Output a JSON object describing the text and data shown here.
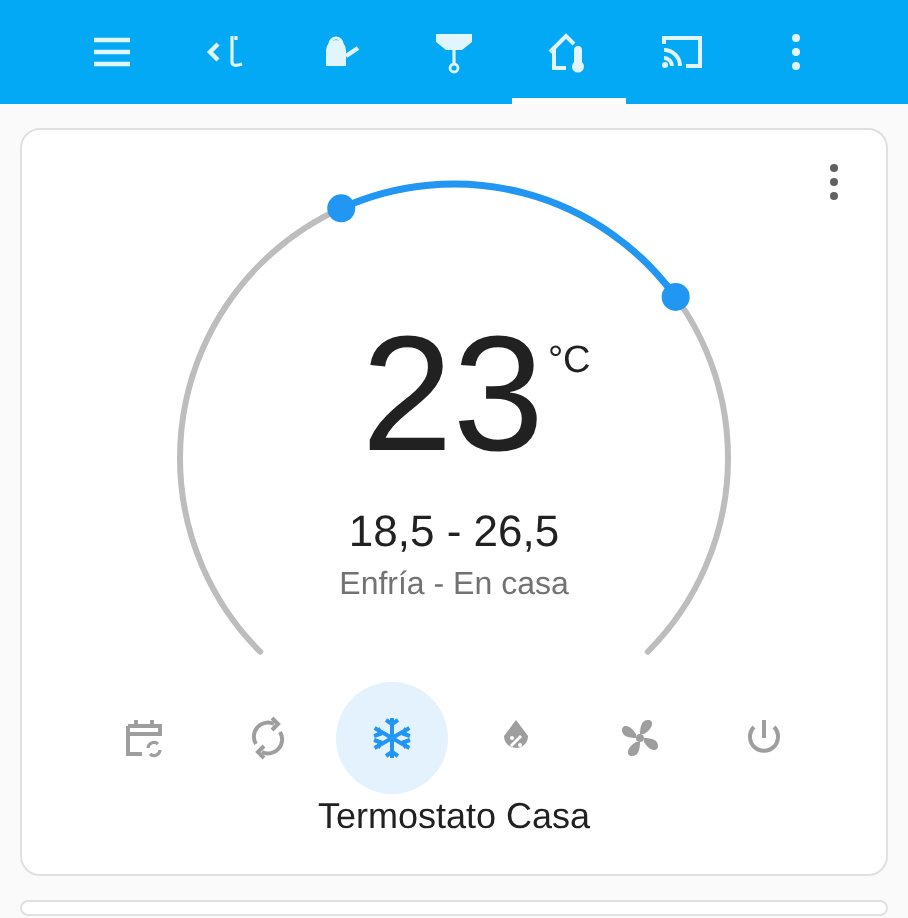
{
  "top_bar": {
    "tabs": [
      {
        "kind": "menu",
        "selected": false
      },
      {
        "kind": "back-plant",
        "selected": false
      },
      {
        "kind": "watering-can",
        "selected": false
      },
      {
        "kind": "ceiling-lamp",
        "selected": false
      },
      {
        "kind": "home-thermometer",
        "selected": true
      },
      {
        "kind": "cast",
        "selected": false
      },
      {
        "kind": "more",
        "selected": false
      }
    ]
  },
  "thermostat_card": {
    "temperature": "23",
    "unit": "°C",
    "range": "18,5 - 26,5",
    "status": "Enfría - En casa",
    "modes": [
      {
        "kind": "schedule",
        "selected": false
      },
      {
        "kind": "auto",
        "selected": false
      },
      {
        "kind": "cool",
        "selected": true
      },
      {
        "kind": "dry",
        "selected": false
      },
      {
        "kind": "fan",
        "selected": false
      },
      {
        "kind": "off",
        "selected": false
      }
    ],
    "name": "Termostato Casa"
  }
}
